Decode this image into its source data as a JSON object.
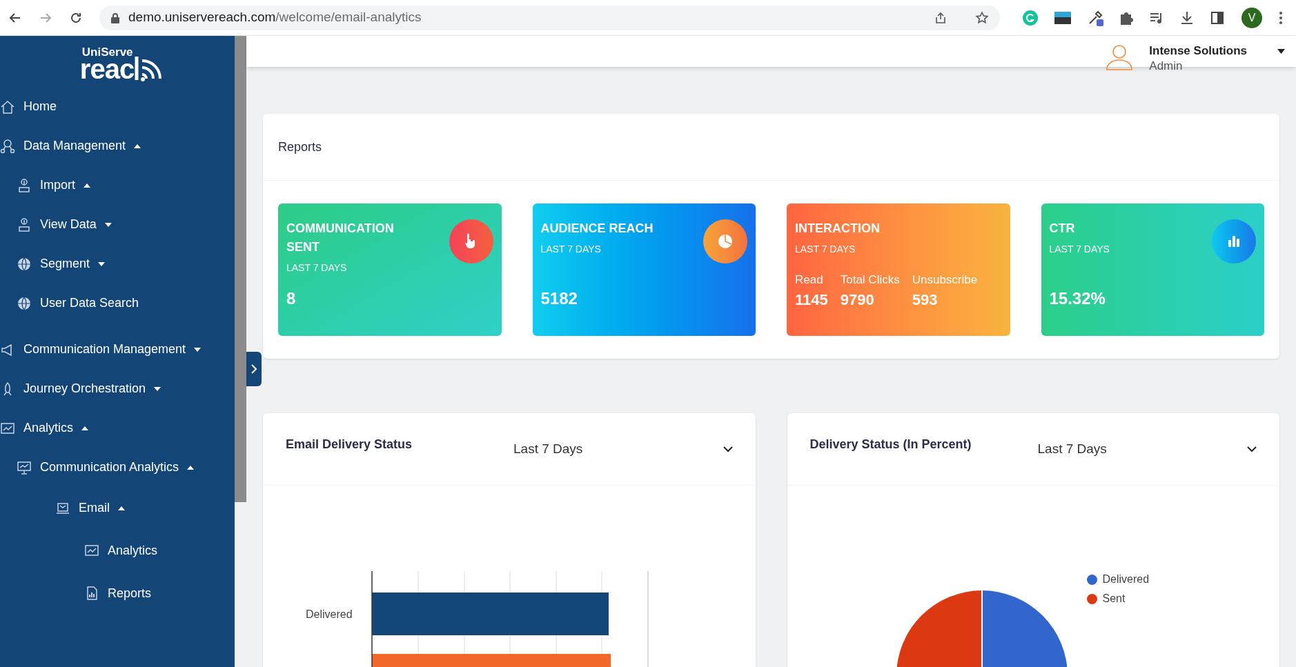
{
  "browser": {
    "url_host": "demo.uniservereach.com",
    "url_path": "/welcome/email-analytics",
    "avatar_letter": "V"
  },
  "logo": {
    "top": "UniServe",
    "bottom": "reac"
  },
  "sidebar": {
    "items": [
      {
        "label": "Home"
      },
      {
        "label": "Data Management",
        "expanded": true,
        "children": [
          {
            "label": "Import",
            "expanded": true
          },
          {
            "label": "View Data",
            "expanded": false
          },
          {
            "label": "Segment",
            "expanded": false
          },
          {
            "label": "User Data Search"
          }
        ]
      },
      {
        "label": "Communication Management",
        "expanded": false
      },
      {
        "label": "Journey Orchestration",
        "expanded": false
      },
      {
        "label": "Analytics",
        "expanded": true,
        "children": [
          {
            "label": "Communication Analytics",
            "expanded": true,
            "children": [
              {
                "label": "Email",
                "expanded": true,
                "children": [
                  {
                    "label": "Analytics"
                  },
                  {
                    "label": "Reports"
                  }
                ]
              }
            ]
          }
        ]
      }
    ]
  },
  "header": {
    "user_name": "Intense Solutions",
    "user_role": "Admin"
  },
  "reports": {
    "title": "Reports",
    "cards": [
      {
        "title": "COMMUNICATION SENT",
        "subtitle": "LAST 7 DAYS",
        "value": "8"
      },
      {
        "title": "AUDIENCE REACH",
        "subtitle": "LAST 7 DAYS",
        "value": "5182"
      },
      {
        "title": "INTERACTION",
        "subtitle": "LAST 7 DAYS",
        "metrics": [
          {
            "label": "Read",
            "value": "1145"
          },
          {
            "label": "Total Clicks",
            "value": "9790"
          },
          {
            "label": "Unsubscribe",
            "value": "593"
          }
        ]
      },
      {
        "title": "CTR",
        "subtitle": "LAST 7 DAYS",
        "value": "15.32%"
      }
    ]
  },
  "charts": [
    {
      "kind": "bar",
      "title": "Email Delivery Status",
      "period": "Last 7 Days",
      "labels": [
        "Delivered"
      ]
    },
    {
      "kind": "pie",
      "title": "Delivery Status (In Percent)",
      "period": "Last 7 Days",
      "legend": [
        {
          "label": "Delivered",
          "color": "#3366cc"
        },
        {
          "label": "Sent",
          "color": "#dc3912"
        }
      ]
    }
  ]
}
